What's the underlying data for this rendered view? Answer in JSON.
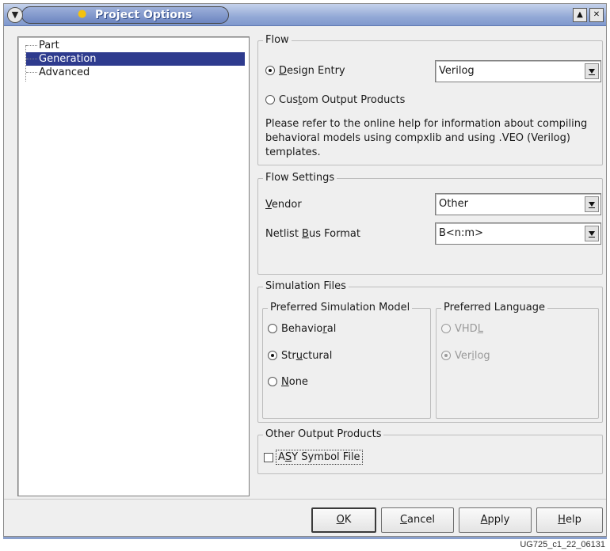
{
  "window": {
    "title": "Project Options"
  },
  "tree": {
    "items": [
      {
        "label": "Part",
        "selected": false
      },
      {
        "label": "Generation",
        "selected": true
      },
      {
        "label": "Advanced",
        "selected": false
      }
    ]
  },
  "flow": {
    "legend": "Flow",
    "design_entry_label": "Design Entry",
    "design_entry_selected": true,
    "design_entry_value": "Verilog",
    "custom_output_label": "Custom Output Products",
    "custom_output_selected": false,
    "info_text": "Please refer to the online help for information about compiling behavioral models using compxlib and using .VEO (Verilog) templates."
  },
  "flow_settings": {
    "legend": "Flow Settings",
    "vendor_label": "Vendor",
    "vendor_value": "Other",
    "netlist_label": "Netlist Bus Format",
    "netlist_value": "B<n:m>"
  },
  "simulation_files": {
    "legend": "Simulation Files",
    "model_legend": "Preferred Simulation Model",
    "models": [
      {
        "label": "Behavioral",
        "selected": false
      },
      {
        "label": "Structural",
        "selected": true
      },
      {
        "label": "None",
        "selected": false
      }
    ],
    "language_legend": "Preferred Language",
    "languages": [
      {
        "label": "VHDL",
        "selected": false,
        "disabled": true
      },
      {
        "label": "Verilog",
        "selected": true,
        "disabled": true
      }
    ]
  },
  "other_output": {
    "legend": "Other Output Products",
    "asy_label": "ASY Symbol File",
    "asy_checked": false
  },
  "buttons": {
    "ok": "OK",
    "cancel": "Cancel",
    "apply": "Apply",
    "help": "Help"
  },
  "figure_id": "UG725_c1_22_06131",
  "icons": {
    "window_menu": "chevron-down-icon",
    "title": "lightbulb-icon",
    "shade": "eject-icon",
    "close": "close-icon"
  }
}
